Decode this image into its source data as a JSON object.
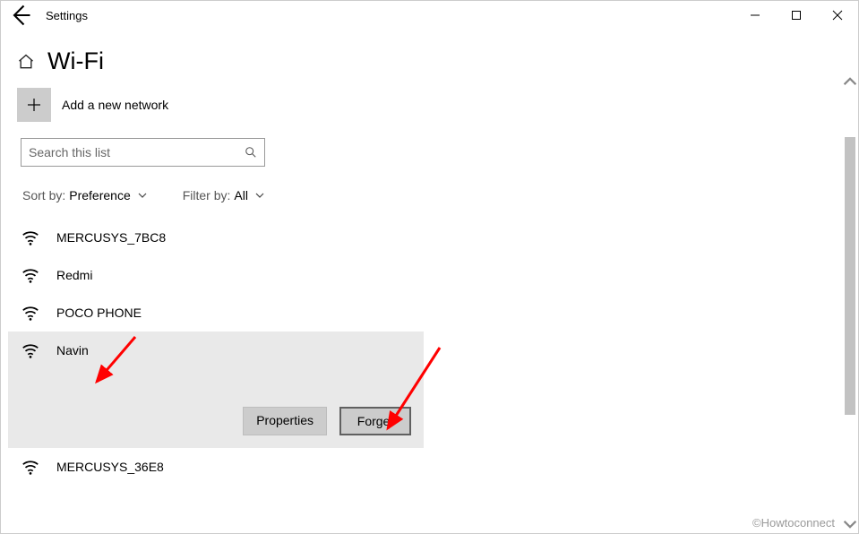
{
  "window": {
    "title": "Settings"
  },
  "page": {
    "title": "Wi-Fi"
  },
  "add_network": {
    "label": "Add a new network"
  },
  "search": {
    "placeholder": "Search this list"
  },
  "sort": {
    "label": "Sort by:",
    "value": "Preference"
  },
  "filter": {
    "label": "Filter by:",
    "value": "All"
  },
  "networks": [
    {
      "name": "MERCUSYS_7BC8"
    },
    {
      "name": "Redmi"
    },
    {
      "name": "POCO PHONE"
    },
    {
      "name": "Navin"
    },
    {
      "name": "MERCUSYS_36E8"
    }
  ],
  "selected_index": 3,
  "buttons": {
    "properties": "Properties",
    "forget": "Forget"
  },
  "watermark": "©Howtoconnect"
}
